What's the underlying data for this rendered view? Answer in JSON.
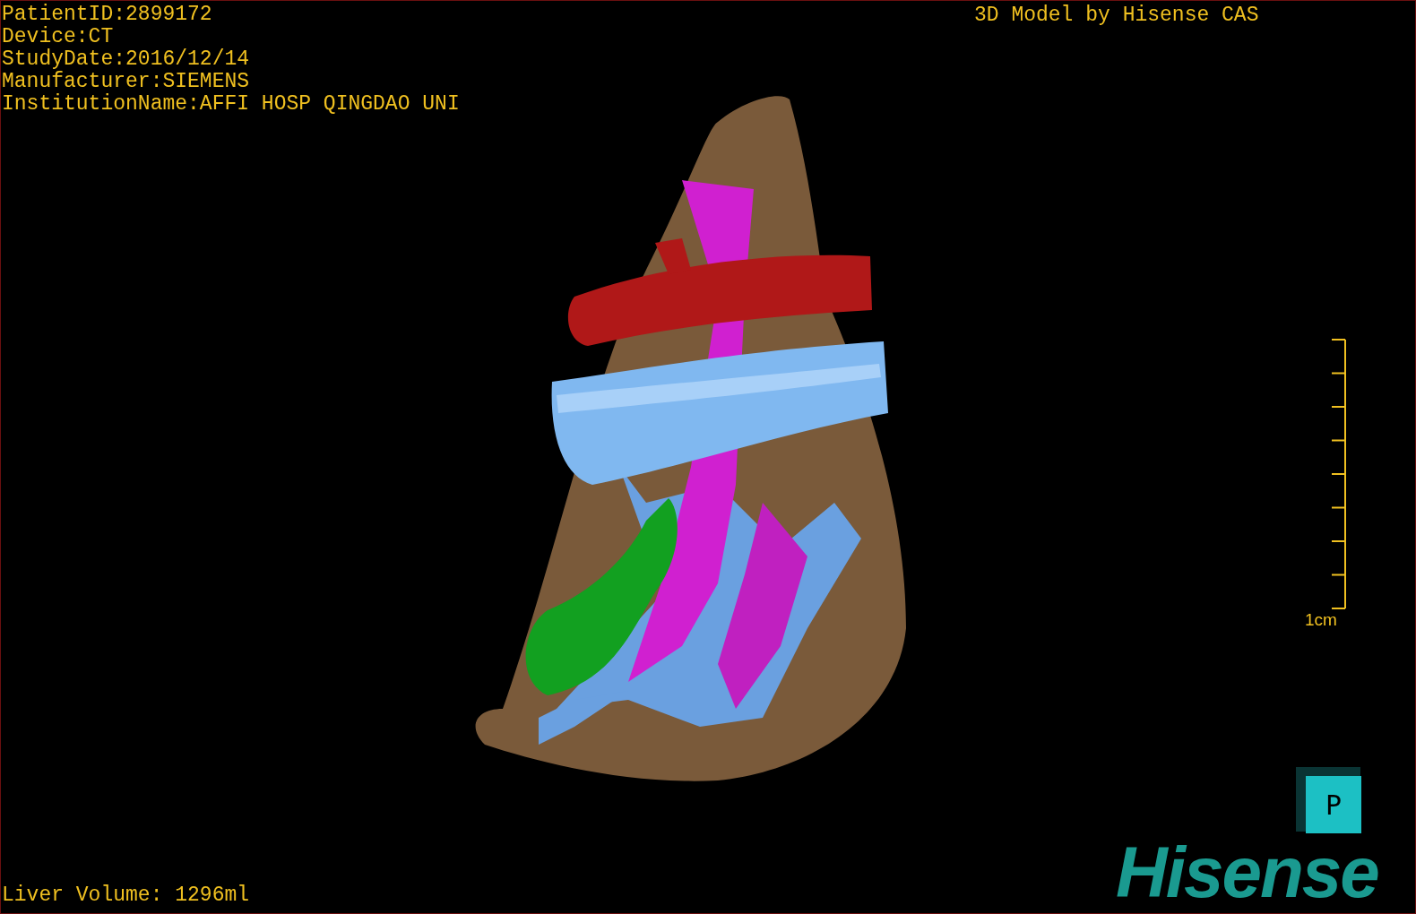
{
  "info_lines": [
    "PatientID:2899172",
    "Device:CT",
    "StudyDate:2016/12/14",
    "Manufacturer:SIEMENS",
    "InstitutionName:AFFI HOSP QINGDAO UNI"
  ],
  "credit": "3D Model by Hisense CAS",
  "scale_bar": {
    "label": "1cm"
  },
  "orientation_cube": {
    "label": "P"
  },
  "logo": "Hisense",
  "status": "Liver Volume: 1296ml"
}
